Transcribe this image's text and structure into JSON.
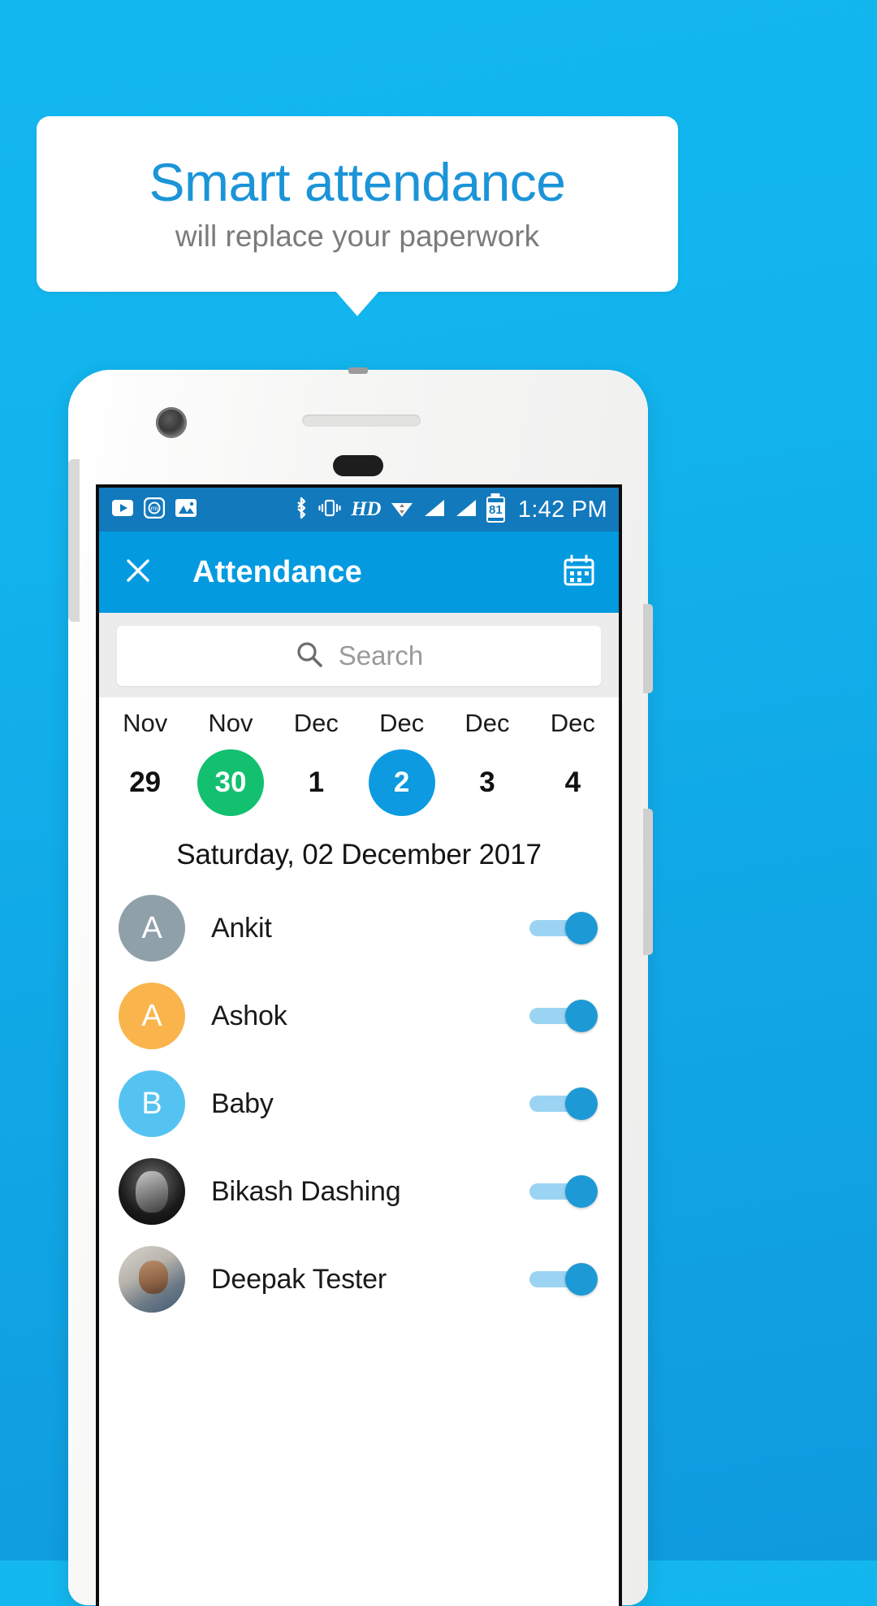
{
  "promo": {
    "title": "Smart attendance",
    "subtitle": "will replace your paperwork",
    "title_color": "#1b94d8",
    "subtitle_color": "#7b7b7b",
    "background_color": "#12b4ed"
  },
  "statusbar": {
    "time": "1:42 PM",
    "battery_percent": "81",
    "hd_label": "HD",
    "left_icons": [
      "youtube-icon",
      "mi-camera-icon",
      "gallery-icon"
    ],
    "right_icons": [
      "bluetooth-icon",
      "vibrate-icon",
      "hd-icon",
      "wifi-icon",
      "signal-icon",
      "signal-icon",
      "battery-icon"
    ],
    "background_color": "#1279bd"
  },
  "appbar": {
    "title": "Attendance",
    "close_icon": "close-icon",
    "calendar_icon": "calendar-icon",
    "background_color": "#039ae0"
  },
  "search": {
    "placeholder": "Search",
    "value": "",
    "icon": "search-icon"
  },
  "datestrip": {
    "days": [
      {
        "month": "Nov",
        "day": "29",
        "state": "normal"
      },
      {
        "month": "Nov",
        "day": "30",
        "state": "today"
      },
      {
        "month": "Dec",
        "day": "1",
        "state": "normal"
      },
      {
        "month": "Dec",
        "day": "2",
        "state": "selected"
      },
      {
        "month": "Dec",
        "day": "3",
        "state": "normal"
      },
      {
        "month": "Dec",
        "day": "4",
        "state": "normal"
      }
    ],
    "today_color": "#12c070",
    "selected_color": "#0d9ae0",
    "selected_full_date": "Saturday, 02 December 2017"
  },
  "people": [
    {
      "name": "Ankit",
      "initial": "A",
      "avatar_type": "initial",
      "avatar_color": "#8fa0a8",
      "present": true
    },
    {
      "name": "Ashok",
      "initial": "A",
      "avatar_type": "initial",
      "avatar_color": "#f9b44c",
      "present": true
    },
    {
      "name": "Baby",
      "initial": "B",
      "avatar_type": "initial",
      "avatar_color": "#55c3f2",
      "present": true
    },
    {
      "name": "Bikash Dashing",
      "initial": "",
      "avatar_type": "photo",
      "avatar_color": "#1a1a1a",
      "present": true
    },
    {
      "name": "Deepak Tester",
      "initial": "",
      "avatar_type": "photo",
      "avatar_color": "#8d8b86",
      "present": true
    }
  ],
  "toggle": {
    "track_color": "#9bd4f2",
    "knob_color": "#1d9ad6"
  }
}
